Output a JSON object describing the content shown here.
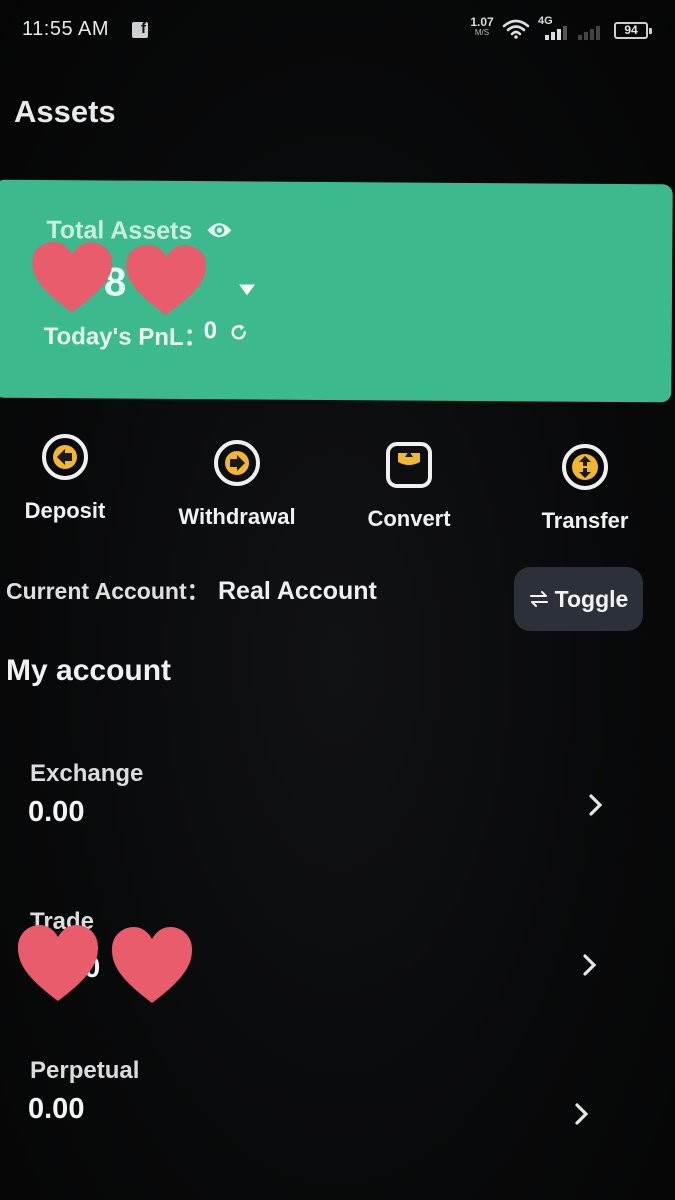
{
  "status_bar": {
    "time": "11:55 AM",
    "speed_value": "1.07",
    "speed_unit": "M/S",
    "network": "4G",
    "battery": "94"
  },
  "page": {
    "title": "Assets"
  },
  "assets_card": {
    "total_label": "Total Assets",
    "balance_partial": "8",
    "pnl_label": "Today's PnL：",
    "pnl_value": "0",
    "color": "#3cba8e"
  },
  "actions": [
    {
      "label": "Deposit",
      "icon": "deposit-icon"
    },
    {
      "label": "Withdrawal",
      "icon": "withdrawal-icon"
    },
    {
      "label": "Convert",
      "icon": "convert-icon"
    },
    {
      "label": "Transfer",
      "icon": "transfer-icon"
    }
  ],
  "current_account": {
    "label": "Current Account：",
    "value": "Real Account",
    "toggle_label": "Toggle"
  },
  "my_account": {
    "title": "My account",
    "rows": [
      {
        "name": "Exchange",
        "amount": "0.00"
      },
      {
        "name": "Trade",
        "amount": "0.0"
      },
      {
        "name": "Perpetual",
        "amount": "0.00"
      }
    ]
  },
  "colors": {
    "background": "#070707",
    "accent": "#3cba8e",
    "heart_mask": "#e85c6c",
    "toggle_bg": "#2b3039"
  }
}
